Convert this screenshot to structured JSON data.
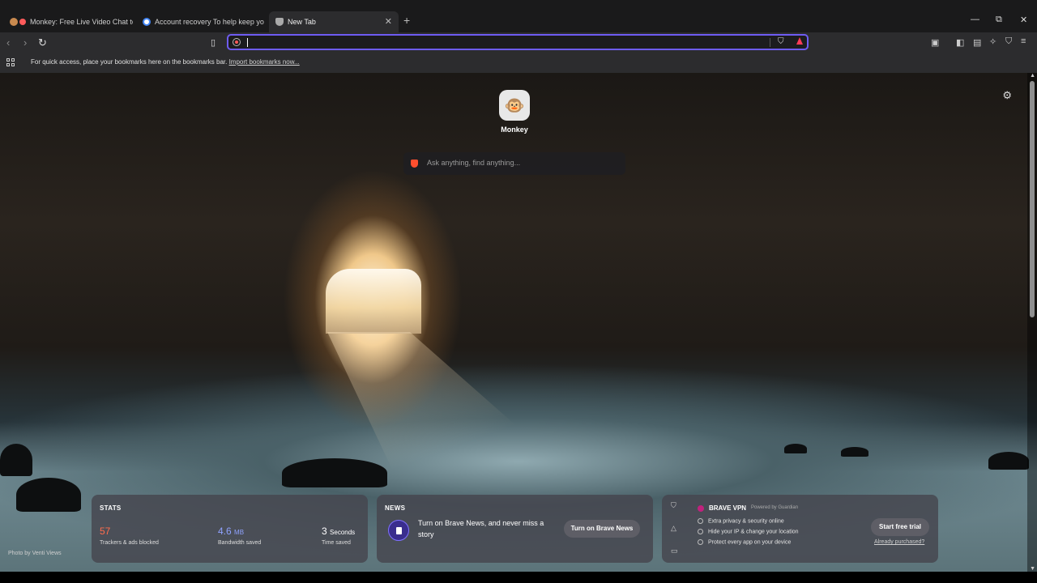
{
  "tabs": [
    {
      "label": "Monkey: Free Live Video Chat to",
      "favicon": "monkey-emoji"
    },
    {
      "label": "Account recovery To help keep your",
      "favicon": "google-icon"
    },
    {
      "label": "New Tab",
      "favicon": "brave-shield-icon"
    }
  ],
  "window_controls": {
    "new_tab": "+",
    "minimize": "—",
    "restore": "⧉",
    "close": "✕",
    "tab_close": "✕"
  },
  "addressbar": {
    "value": "",
    "placeholder": ""
  },
  "bookmarks_bar": {
    "message": "For quick access, place your bookmarks here on the bookmarks bar.",
    "import_link": "Import bookmarks now..."
  },
  "top_sites": [
    {
      "label": "Monkey",
      "icon": "🐵"
    }
  ],
  "search": {
    "placeholder": "Ask anything, find anything..."
  },
  "stats": {
    "title": "STATS",
    "trackers": {
      "value": "57",
      "label": "Trackers & ads blocked"
    },
    "bandwidth": {
      "value": "4.6",
      "unit": "MB",
      "label": "Bandwidth saved"
    },
    "time": {
      "value": "3",
      "unit": "Seconds",
      "label": "Time saved"
    }
  },
  "news": {
    "title": "NEWS",
    "text": "Turn on Brave News, and never miss a story",
    "button": "Turn on Brave News"
  },
  "vpn": {
    "title": "BRAVE VPN",
    "powered": "Powered by Guardian",
    "features": [
      "Extra privacy & security online",
      "Hide your IP & change your location",
      "Protect every app on your device"
    ],
    "button": "Start free trial",
    "link": "Already purchased?"
  },
  "photo_credit": "Photo by Venti Views",
  "colors": {
    "accent": "#6e5cf2",
    "trackers": "#ff6d4d",
    "bandwidth": "#8fa3ff",
    "brave": "#ff4f2e"
  }
}
